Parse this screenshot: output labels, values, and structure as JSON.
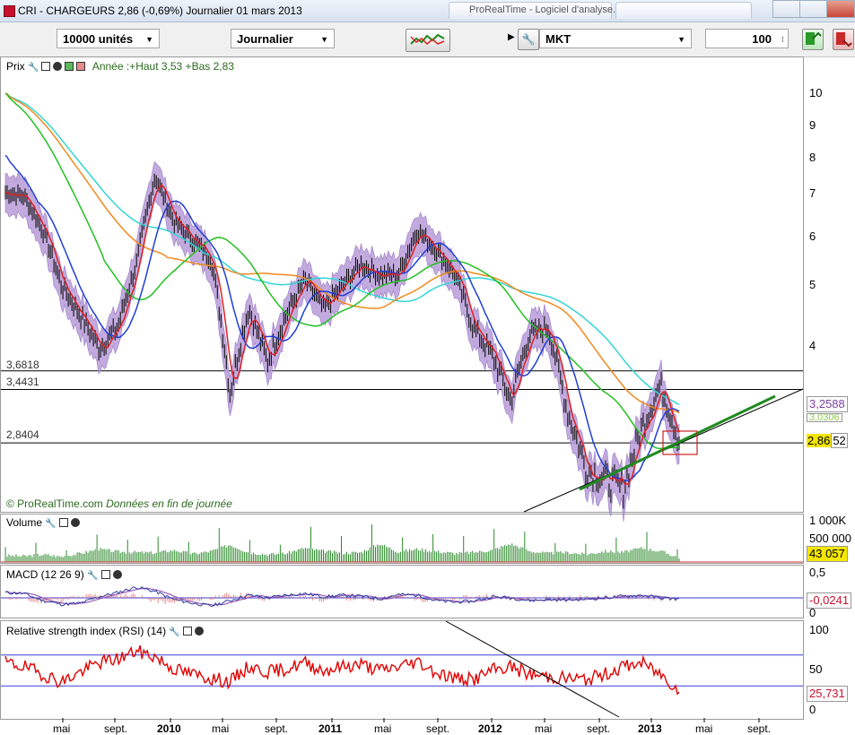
{
  "window": {
    "title": "CRI - CHARGEURS    2,86 (-0,69%)    Journalier  01 mars 2013",
    "tab_text": "ProRealTime - Logiciel d'analyse..."
  },
  "toolbar": {
    "quantity": "10000 unités",
    "period": "Journalier",
    "order_type": "MKT",
    "order_qty": "100"
  },
  "price_panel": {
    "header_label": "Prix",
    "annotation": "Année :+Haut 3,53 +Bas 2,83",
    "credit": "© ProRealTime.com",
    "credit_note": "Données en fin de journée",
    "y_ticks": [
      "10",
      "9",
      "8",
      "7",
      "6",
      "5",
      "4"
    ],
    "levels": [
      {
        "label": "3,6818",
        "value": 3.6818
      },
      {
        "label": "3,4431",
        "value": 3.4431
      },
      {
        "label": "2,8404",
        "value": 2.8404
      }
    ],
    "tags": {
      "ma_top": "3,2588",
      "ma_mid": "3,0306",
      "last_main": "2,86",
      "last_tail": "52"
    }
  },
  "volume_panel": {
    "label": "Volume",
    "y_ticks": [
      "1 000K",
      "500 000"
    ],
    "last": "43 057"
  },
  "macd_panel": {
    "label": "MACD (12 26 9)",
    "y_ticks": [
      "0,5",
      "0"
    ],
    "last": "-0,0241"
  },
  "rsi_panel": {
    "label": "Relative strength index (RSI) (14)",
    "y_ticks": [
      "100",
      "50",
      "0"
    ],
    "last": "25,731"
  },
  "x_axis": [
    {
      "label": "mai",
      "bold": false
    },
    {
      "label": "sept.",
      "bold": false
    },
    {
      "label": "2010",
      "bold": true
    },
    {
      "label": "mai",
      "bold": false
    },
    {
      "label": "sept.",
      "bold": false
    },
    {
      "label": "2011",
      "bold": true
    },
    {
      "label": "mai",
      "bold": false
    },
    {
      "label": "sept.",
      "bold": false
    },
    {
      "label": "2012",
      "bold": true
    },
    {
      "label": "mai",
      "bold": false
    },
    {
      "label": "sept.",
      "bold": false
    },
    {
      "label": "2013",
      "bold": true
    },
    {
      "label": "mai",
      "bold": false
    },
    {
      "label": "sept.",
      "bold": false
    }
  ],
  "colors": {
    "band": "#b79bd8",
    "price": "#111111",
    "ma_blue": "#1f3fd6",
    "ma_cyan": "#33d5d5",
    "ma_green": "#22c022",
    "ma_orange": "#f08a1e",
    "ma_red": "#e02020",
    "trend": "#1f8a1f",
    "rsi": "#e00000",
    "box": "#cc2222"
  },
  "chart_data": {
    "type": "line",
    "series": [
      {
        "name": "Prix",
        "values": [
          7.0,
          6.9,
          6.1,
          5.0,
          4.5,
          4.0,
          4.3,
          5.4,
          7.4,
          6.3,
          5.9,
          5.5,
          3.4,
          4.6,
          3.8,
          4.5,
          5.1,
          4.6,
          5.0,
          5.4,
          5.2,
          5.2,
          6.1,
          5.7,
          5.2,
          4.3,
          3.9,
          3.3,
          4.2,
          4.3,
          3.2,
          2.6,
          2.5,
          2.4,
          3.0,
          3.5,
          2.86
        ]
      }
    ],
    "y_scale": "log",
    "ylim": [
      2.3,
      11
    ],
    "volume": [
      60,
      55,
      70,
      50,
      80,
      120,
      95,
      90,
      85,
      110,
      75,
      100,
      160,
      90,
      70,
      80,
      130,
      100,
      85,
      90,
      170,
      95,
      120,
      100,
      80,
      90,
      110,
      170,
      100,
      80,
      90,
      70,
      100,
      90,
      130,
      100,
      43
    ],
    "macd": [
      0.1,
      0.08,
      -0.05,
      -0.12,
      -0.1,
      0.02,
      0.1,
      0.2,
      0.12,
      -0.03,
      -0.1,
      -0.15,
      -0.05,
      0.05,
      0.0,
      0.05,
      0.08,
      0.02,
      0.05,
      0.03,
      -0.02,
      0.06,
      0.05,
      -0.05,
      -0.08,
      -0.06,
      0.02,
      0.0,
      -0.05,
      -0.03,
      -0.04,
      -0.02,
      0.0,
      0.03,
      0.05,
      0.0,
      -0.0241
    ],
    "rsi": [
      60,
      55,
      45,
      35,
      48,
      60,
      65,
      75,
      68,
      52,
      45,
      40,
      35,
      55,
      48,
      52,
      60,
      50,
      55,
      58,
      50,
      55,
      62,
      48,
      40,
      38,
      50,
      55,
      45,
      42,
      40,
      38,
      45,
      55,
      60,
      45,
      25.731
    ]
  }
}
